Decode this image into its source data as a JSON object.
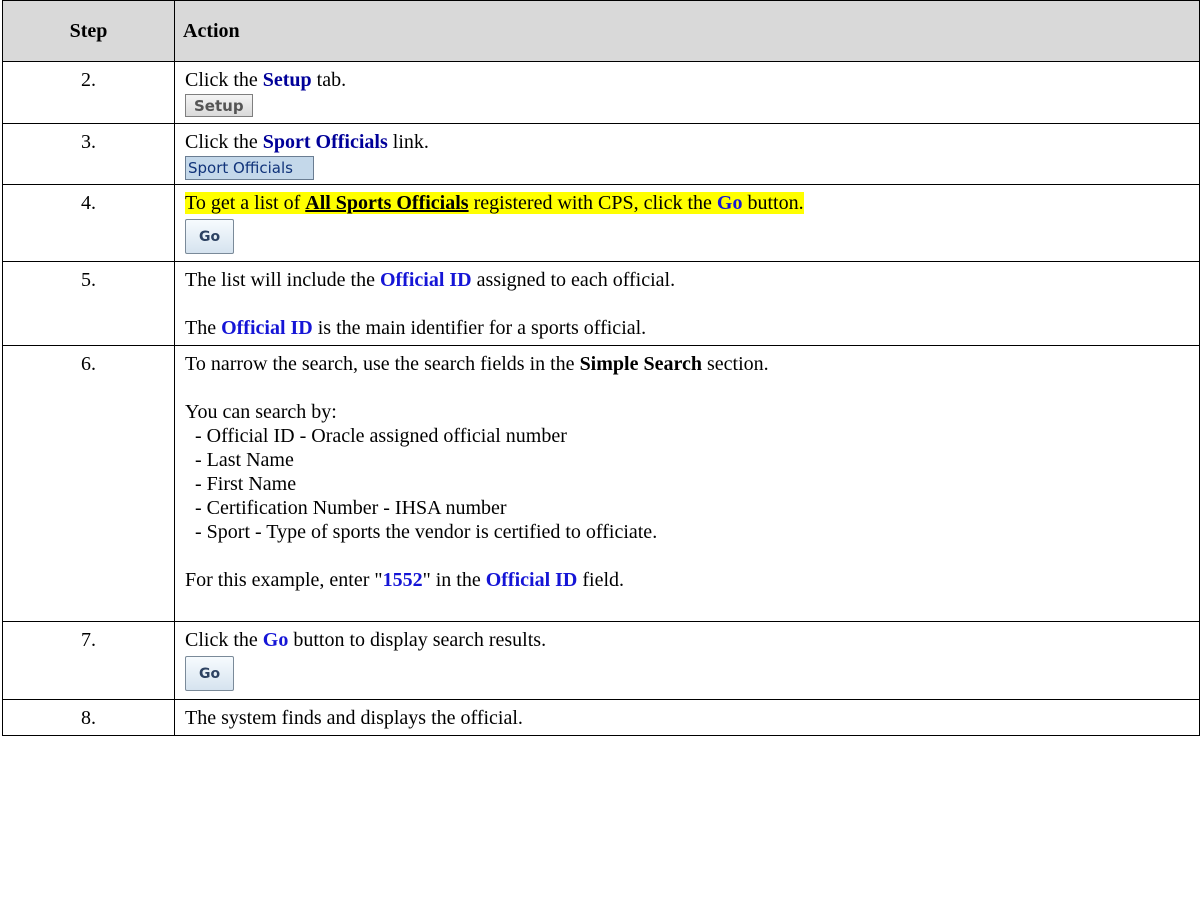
{
  "header": {
    "step": "Step",
    "action": "Action"
  },
  "rows": [
    {
      "step": "2.",
      "pre": "Click the ",
      "kw": "Setup",
      "post": " tab.",
      "widget": "Setup"
    },
    {
      "step": "3.",
      "pre": "Click the ",
      "kw": "Sport Officials",
      "post": " link.",
      "widget": "Sport Officials"
    },
    {
      "step": "4.",
      "pre": "To get a list of ",
      "kw": "All Sports Officials",
      "mid": " registered with CPS, click the ",
      "kw2": "Go",
      "post": " button.",
      "widget": "Go"
    },
    {
      "step": "5.",
      "line1_pre": "The list will include the ",
      "line1_kw": "Official ID",
      "line1_post": " assigned to each official.",
      "line2_pre": "The ",
      "line2_kw": "Official ID",
      "line2_post": " is the main identifier for a sports official."
    },
    {
      "step": "6.",
      "line1_pre": "To narrow the search, use the search fields in the ",
      "line1_kw": "Simple Search",
      "line1_post": " section.",
      "intro": "You can search by:",
      "items": [
        "- Official ID - Oracle assigned official number",
        "- Last Name",
        "- First Name",
        "- Certification Number - IHSA number",
        "- Sport - Type of sports the vendor is certified to officiate."
      ],
      "ex_pre": "For this example, enter \"",
      "ex_val": "1552",
      "ex_mid": "\" in the ",
      "ex_kw": "Official ID",
      "ex_post": " field."
    },
    {
      "step": "7.",
      "pre": "Click the ",
      "kw": "Go",
      "post": " button to display search results.",
      "widget": "Go"
    },
    {
      "step": "8.",
      "text": "The system finds and displays the official."
    }
  ],
  "colors": {
    "keyword": "#000099",
    "keyword_bright": "#1515d6",
    "highlight": "#ffff00",
    "header_bg": "#d9d9d9"
  }
}
